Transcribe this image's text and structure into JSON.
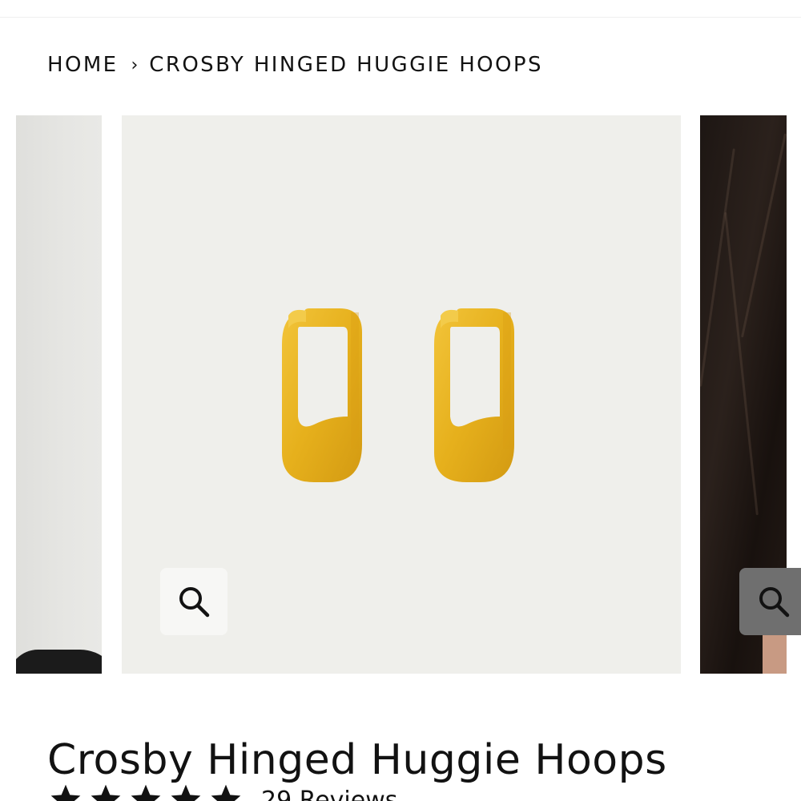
{
  "breadcrumb": {
    "home": "HOME",
    "separator": "›",
    "current": "CROSBY HINGED HUGGIE HOOPS"
  },
  "gallery": {
    "zoom_icon": "magnifier-icon"
  },
  "product": {
    "title": "Crosby Hinged Huggie Hoops",
    "rating_stars": 5,
    "reviews_text": "29 Reviews"
  },
  "colors": {
    "text": "#121212",
    "gold": "#e8b21c",
    "image_bg": "#efefeb"
  }
}
